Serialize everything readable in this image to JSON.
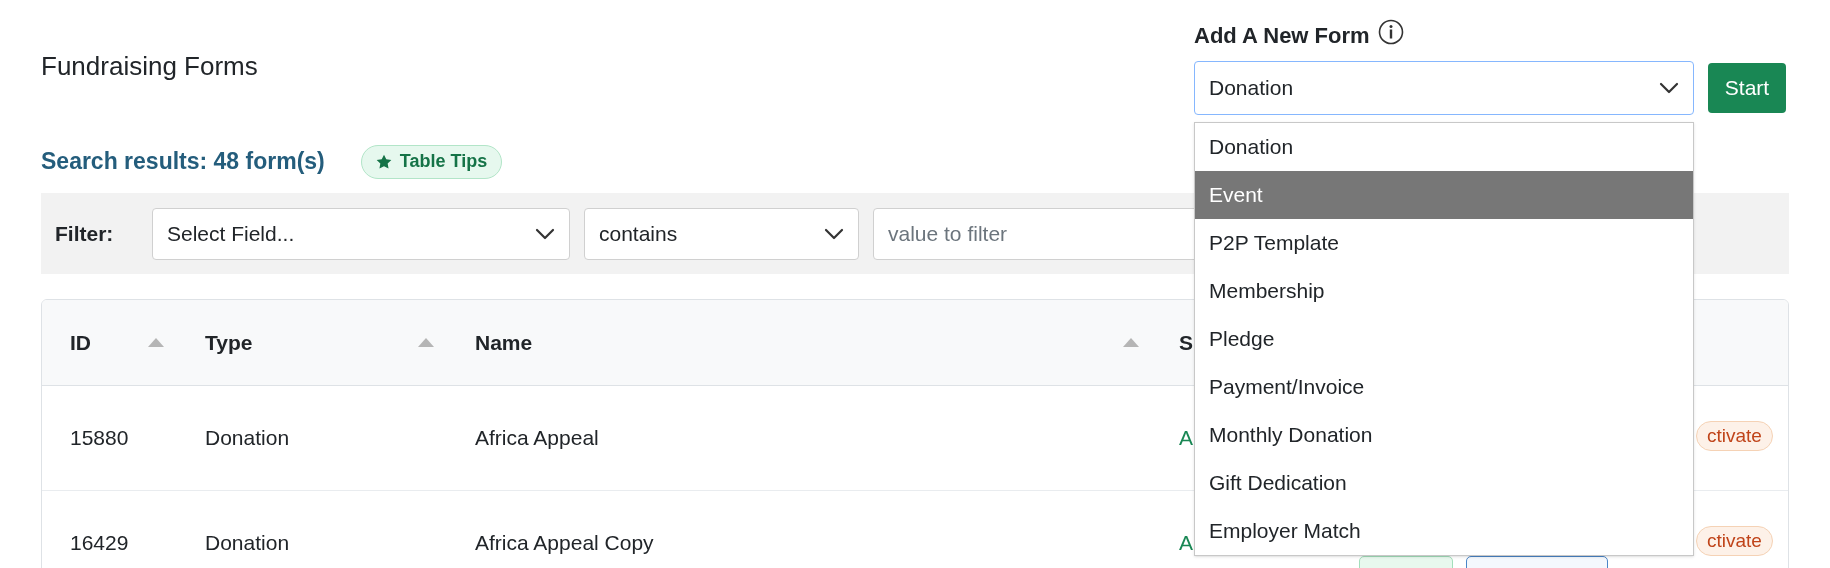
{
  "page_title": "Fundraising Forms",
  "add_form": {
    "label": "Add A New Form",
    "select_value": "Donation",
    "button": "Start",
    "dropdown_open": true,
    "options": [
      {
        "label": "Donation",
        "selected": false
      },
      {
        "label": "Event",
        "selected": true
      },
      {
        "label": "P2P Template",
        "selected": false
      },
      {
        "label": "Membership",
        "selected": false
      },
      {
        "label": "Pledge",
        "selected": false
      },
      {
        "label": "Payment/Invoice",
        "selected": false
      },
      {
        "label": "Monthly Donation",
        "selected": false
      },
      {
        "label": "Gift Dedication",
        "selected": false
      },
      {
        "label": "Employer Match",
        "selected": false
      }
    ]
  },
  "search_results": "Search results: 48 form(s)",
  "table_tips": "Table Tips",
  "filter": {
    "label": "Filter:",
    "field_select": "Select Field...",
    "operator_select": "contains",
    "value_placeholder": "value to filter"
  },
  "table": {
    "columns": [
      {
        "label": "ID",
        "sortable": true
      },
      {
        "label": "Type",
        "sortable": true
      },
      {
        "label": "Name",
        "sortable": true
      },
      {
        "label": "S"
      }
    ],
    "rows": [
      {
        "id": "15880",
        "type": "Donation",
        "name": "Africa Appeal",
        "status": "A",
        "badge": "ctivate",
        "action_buttons": []
      },
      {
        "id": "16429",
        "type": "Donation",
        "name": "Africa Appeal Copy",
        "status": "A",
        "badge": "ctivate",
        "action_buttons": [
          {
            "kind": "success"
          },
          {
            "kind": "primary"
          }
        ]
      }
    ]
  }
}
